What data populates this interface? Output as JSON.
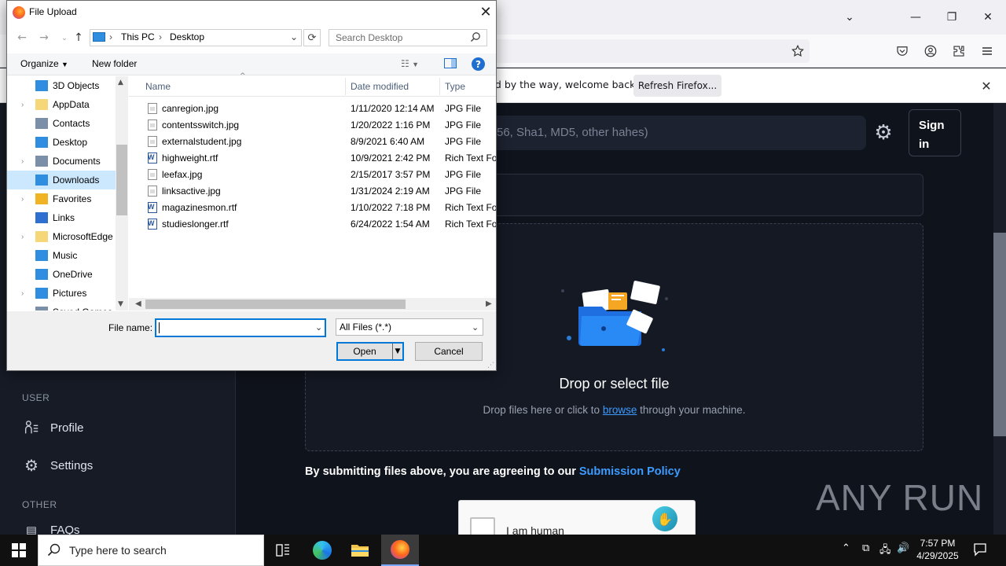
{
  "browser": {
    "notification_text": "nd by the way, welcome back!",
    "refresh_button": "Refresh Firefox..."
  },
  "page": {
    "search_placeholder": "56, Sha1, MD5, other hahes)",
    "signin": "Sign in",
    "sidebar": {
      "user_section": "USER",
      "profile": "Profile",
      "settings": "Settings",
      "other_section": "OTHER",
      "faqs": "FAQs"
    },
    "dropzone": {
      "title": "Drop or select file",
      "sub_before": "Drop files here or click to",
      "sub_link": "browse",
      "sub_after": "through your machine."
    },
    "policy": {
      "text": "By submitting files above, you are agreeing to our",
      "link": "Submission Policy"
    },
    "captcha_label": "I am human",
    "watermark": "ANY RUN"
  },
  "dialog": {
    "title": "File Upload",
    "breadcrumb": [
      "This PC",
      "Desktop"
    ],
    "search_placeholder": "Search Desktop",
    "toolbar": {
      "organize": "Organize",
      "new_folder": "New folder"
    },
    "tree": [
      {
        "label": "3D Objects",
        "expandable": false,
        "selected": false
      },
      {
        "label": "AppData",
        "expandable": true,
        "selected": false
      },
      {
        "label": "Contacts",
        "expandable": false,
        "selected": false
      },
      {
        "label": "Desktop",
        "expandable": false,
        "selected": false
      },
      {
        "label": "Documents",
        "expandable": true,
        "selected": false
      },
      {
        "label": "Downloads",
        "expandable": false,
        "selected": true
      },
      {
        "label": "Favorites",
        "expandable": true,
        "selected": false
      },
      {
        "label": "Links",
        "expandable": false,
        "selected": false
      },
      {
        "label": "MicrosoftEdge",
        "expandable": true,
        "selected": false
      },
      {
        "label": "Music",
        "expandable": false,
        "selected": false
      },
      {
        "label": "OneDrive",
        "expandable": false,
        "selected": false
      },
      {
        "label": "Pictures",
        "expandable": true,
        "selected": false
      },
      {
        "label": "Saved Games",
        "expandable": false,
        "selected": false
      }
    ],
    "columns": {
      "name": "Name",
      "date": "Date modified",
      "type": "Type"
    },
    "files": [
      {
        "name": "canregion.jpg",
        "date": "1/11/2020 12:14 AM",
        "type": "JPG File",
        "kind": "jpg"
      },
      {
        "name": "contentsswitch.jpg",
        "date": "1/20/2022 1:16 PM",
        "type": "JPG File",
        "kind": "jpg"
      },
      {
        "name": "externalstudent.jpg",
        "date": "8/9/2021 6:40 AM",
        "type": "JPG File",
        "kind": "jpg"
      },
      {
        "name": "highweight.rtf",
        "date": "10/9/2021 2:42 PM",
        "type": "Rich Text For",
        "kind": "rtf"
      },
      {
        "name": "leefax.jpg",
        "date": "2/15/2017 3:57 PM",
        "type": "JPG File",
        "kind": "jpg"
      },
      {
        "name": "linksactive.jpg",
        "date": "1/31/2024 2:19 AM",
        "type": "JPG File",
        "kind": "jpg"
      },
      {
        "name": "magazinesmon.rtf",
        "date": "1/10/2022 7:18 PM",
        "type": "Rich Text For",
        "kind": "rtf"
      },
      {
        "name": "studieslonger.rtf",
        "date": "6/24/2022 1:54 AM",
        "type": "Rich Text For",
        "kind": "rtf"
      }
    ],
    "filename_label": "File name:",
    "filename_value": "",
    "filetype": "All Files (*.*)",
    "open_button": "Open",
    "cancel_button": "Cancel"
  },
  "taskbar": {
    "search_placeholder": "Type here to search",
    "time": "7:57 PM",
    "date": "4/29/2025"
  }
}
